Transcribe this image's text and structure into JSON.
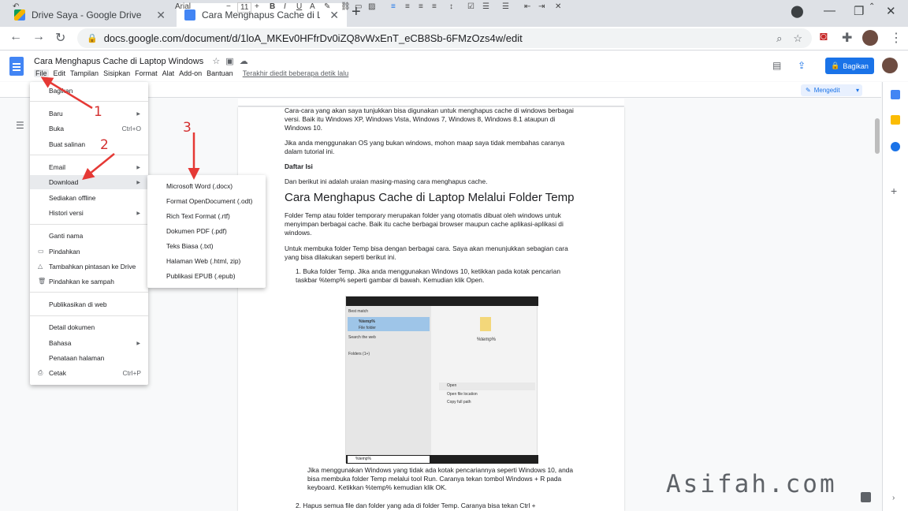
{
  "browser": {
    "tabs": [
      {
        "label": "Drive Saya - Google Drive"
      },
      {
        "label": "Cara Menghapus Cache di Laptop"
      }
    ],
    "url": "docs.google.com/document/d/1loA_MKEv0HFfrDv0iZQ8vWxEnT_eCB8Sb-6FMzOzs4w/edit"
  },
  "doc": {
    "title": "Cara Menghapus Cache di Laptop Windows",
    "menus": [
      "File",
      "Edit",
      "Tampilan",
      "Sisipkan",
      "Format",
      "Alat",
      "Add-on",
      "Bantuan"
    ],
    "last_edit": "Terakhir diedit beberapa detik lalu",
    "share": "Bagikan",
    "mode": "Mengedit",
    "toolbar": {
      "font": "Arial",
      "size": "11"
    }
  },
  "file_menu": {
    "items": [
      {
        "label": "Bagikan"
      },
      {
        "label": "Baru",
        "arrow": "▶"
      },
      {
        "label": "Buka",
        "shortcut": "Ctrl+O"
      },
      {
        "label": "Buat salinan"
      },
      {
        "label": "Email",
        "arrow": "▶"
      },
      {
        "label": "Download",
        "arrow": "▶"
      },
      {
        "label": "Sediakan offline"
      },
      {
        "label": "Histori versi",
        "arrow": "▶"
      },
      {
        "label": "Ganti nama"
      },
      {
        "label": "Pindahkan"
      },
      {
        "label": "Tambahkan pintasan ke Drive"
      },
      {
        "label": "Pindahkan ke sampah"
      },
      {
        "label": "Publikasikan di web"
      },
      {
        "label": "Detail dokumen"
      },
      {
        "label": "Bahasa",
        "arrow": "▶"
      },
      {
        "label": "Penataan halaman"
      },
      {
        "label": "Cetak",
        "shortcut": "Ctrl+P"
      }
    ]
  },
  "download_menu": {
    "items": [
      "Microsoft Word (.docx)",
      "Format OpenDocument (.odt)",
      "Rich Text Format (.rtf)",
      "Dokumen PDF (.pdf)",
      "Teks Biasa (.txt)",
      "Halaman Web (.html, zip)",
      "Publikasi EPUB (.epub)"
    ]
  },
  "annotations": {
    "n1": "1",
    "n2": "2",
    "n3": "3",
    "watermark": "Asifah.com"
  },
  "content": {
    "p1": "Cara-cara yang akan saya tunjukkan bisa digunakan untuk menghapus cache di windows berbagai versi.  Baik itu Windows XP, Windows Vista, Windows 7, Windows 8, Windows 8.1 ataupun di Windows 10.",
    "p2": "Jika anda menggunakan OS yang bukan windows, mohon maap saya tidak membahas caranya dalam  tutorial ini.",
    "p3": "Daftar Isi",
    "p4": "Dan berikut ini adalah uraian masing-masing cara menghapus cache.",
    "h1": "Cara Menghapus Cache di Laptop Melalui Folder Temp",
    "p5": "Folder Temp atau folder temporary merupakan folder yang otomatis dibuat oleh windows untuk menyimpan berbagai cache. Baik itu cache berbagai browser maupun cache aplikasi-aplikasi di windows.",
    "p6": "Untuk membuka folder Temp bisa dengan berbagai cara. Saya akan menunjukkan sebagian cara yang  bisa dilakukan seperti berikut ini.",
    "li1": "1.  Buka folder Temp. Jika anda menggunakan Windows 10, ketikkan pada kotak pencarian taskbar %temp% seperti gambar di bawah. Kemudian klik Open.",
    "p7": "Jika menggunakan Windows yang tidak ada kotak pencariannya seperti Windows 10, anda bisa  membuka folder Temp melalui tool Run. Caranya tekan tombol Windows + R pada keyboard. Ketikkan %temp% kemudian klik OK.",
    "li2": "2.  Hapus semua file dan folder yang ada di folder Temp. Caranya bisa tekan Ctrl +"
  },
  "screenshot": {
    "best_match": "Best match",
    "item": "%temp%",
    "item_sub": "File folder",
    "web": "Search the web",
    "folders": "Folders (1+)",
    "search": "%temp%",
    "open": "Open",
    "open_loc": "Open file location",
    "copy": "Copy full path"
  }
}
